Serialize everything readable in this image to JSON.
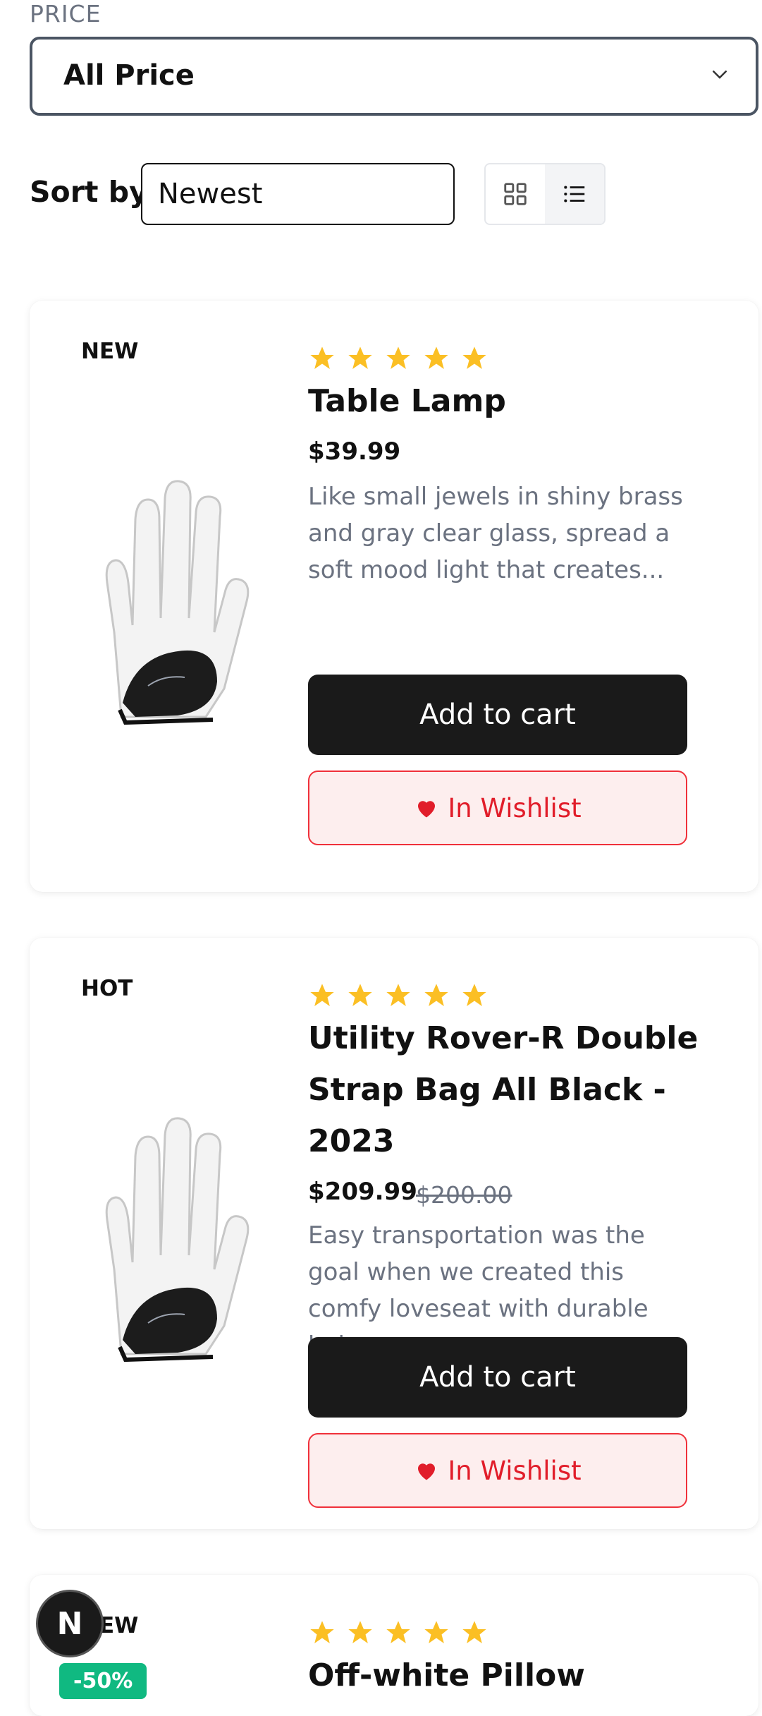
{
  "filters": {
    "price_label": "PRICE",
    "price_value": "All Price",
    "sort_label": "Sort by",
    "sort_value": "Newest"
  },
  "colors": {
    "star": "#fbbf24",
    "wishlist": "#e11d2a",
    "sale": "#10b981",
    "cart": "#1a1a1a"
  },
  "products": [
    {
      "badge": "NEW",
      "rating": 5,
      "title": "Table Lamp",
      "price": "$39.99",
      "description": "Like small jewels in shiny brass and gray clear glass, spread a soft mood light that creates...",
      "cart_label": "Add to cart",
      "wishlist_label": "In Wishlist"
    },
    {
      "badge": "HOT",
      "rating": 5,
      "title": "Utility Rover-R Double Strap Bag All Black - 2023",
      "price": "$209.99",
      "old_price": "$200.00",
      "description": "Easy transportation was the goal when we created this comfy loveseat with durable beige...",
      "cart_label": "Add to cart",
      "wishlist_label": "In Wishlist"
    },
    {
      "badge": "NEW",
      "sale": "-50%",
      "rating": 5,
      "title": "Off-white Pillow"
    }
  ],
  "fab": {
    "label": "N"
  }
}
